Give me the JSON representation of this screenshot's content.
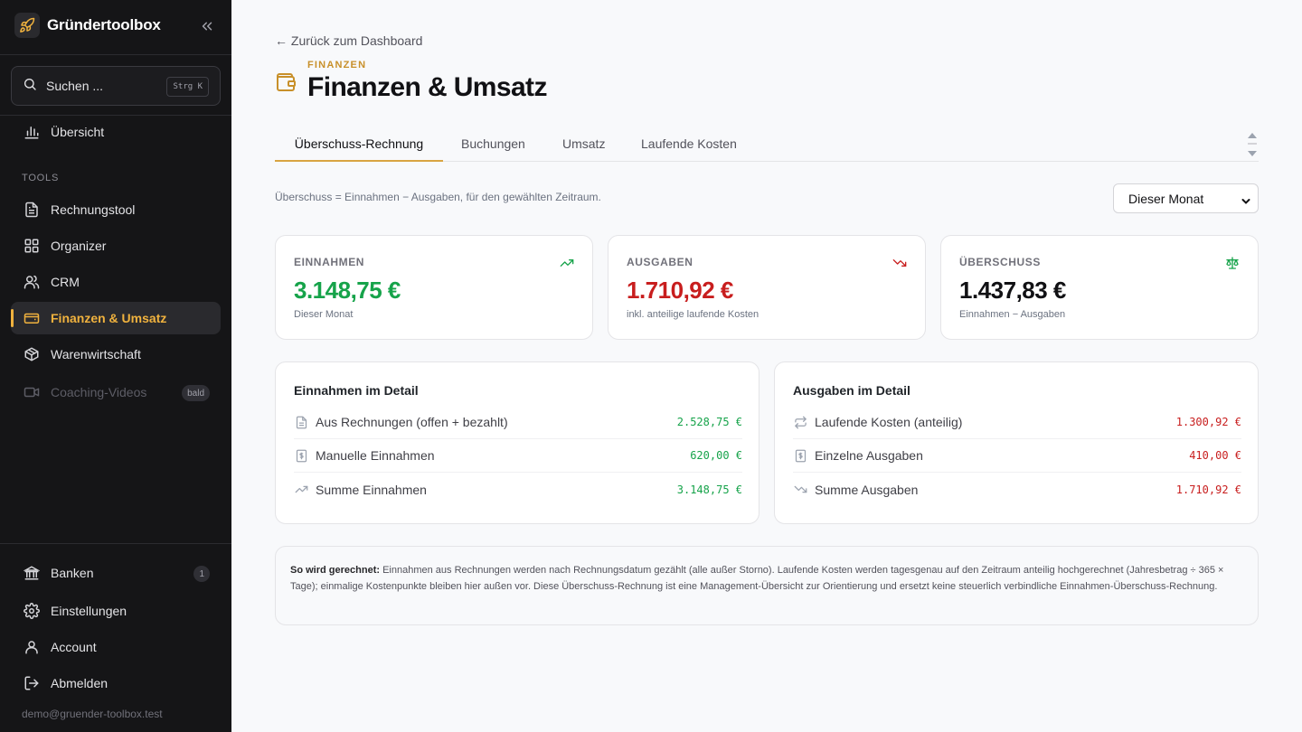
{
  "brand": {
    "name": "Gründertoolbox"
  },
  "search": {
    "placeholder": "Suchen ...",
    "shortcut": "Strg K"
  },
  "nav": {
    "overview": "Übersicht",
    "section_label": "TOOLS",
    "items": [
      {
        "label": "Rechnungstool",
        "icon": "document-icon"
      },
      {
        "label": "Organizer",
        "icon": "grid-icon"
      },
      {
        "label": "CRM",
        "icon": "users-icon"
      },
      {
        "label": "Finanzen & Umsatz",
        "icon": "wallet-icon"
      },
      {
        "label": "Warenwirtschaft",
        "icon": "box-icon"
      },
      {
        "label": "Coaching-Videos",
        "icon": "video-icon",
        "badge": "bald"
      }
    ],
    "bottom": [
      {
        "label": "Banken",
        "icon": "bank-icon",
        "badge": "1"
      },
      {
        "label": "Einstellungen",
        "icon": "gear-icon"
      },
      {
        "label": "Account",
        "icon": "user-icon"
      },
      {
        "label": "Abmelden",
        "icon": "logout-icon"
      }
    ],
    "email": "demo@gruender-toolbox.test"
  },
  "colors": {
    "accent": "#f0b23e",
    "income": "#16a34a",
    "expense": "#c81e1e",
    "sidebar_bg": "#151517"
  },
  "page": {
    "back_link": "← Zurück zum Dashboard",
    "kicker": "FINANZEN",
    "title": "Finanzen & Umsatz",
    "tabs": [
      "Überschuss-Rechnung",
      "Buchungen",
      "Umsatz",
      "Laufende Kosten"
    ],
    "hint": "Überschuss = Einnahmen − Ausgaben, für den gewählten Zeitraum.",
    "period": "Dieser Monat"
  },
  "kpis": [
    {
      "label": "EINNAHMEN",
      "value": "3.148,75 €",
      "sub": "Dieser Monat",
      "icon": "trending-up-icon"
    },
    {
      "label": "AUSGABEN",
      "value": "1.710,92 €",
      "sub": "inkl. anteilige laufende Kosten",
      "icon": "trending-down-icon"
    },
    {
      "label": "ÜBERSCHUSS",
      "value": "1.437,83 €",
      "sub": "Einnahmen − Ausgaben",
      "icon": "scale-icon"
    }
  ],
  "income_detail": {
    "title": "Einnahmen im Detail",
    "rows": [
      {
        "label": "Aus Rechnungen (offen + bezahlt)",
        "value": "2.528,75 €",
        "icon": "document-icon"
      },
      {
        "label": "Manuelle Einnahmen",
        "value": "620,00 €",
        "icon": "receipt-icon"
      },
      {
        "label": "Summe Einnahmen",
        "value": "3.148,75 €",
        "icon": "trending-up-icon"
      }
    ]
  },
  "expense_detail": {
    "title": "Ausgaben im Detail",
    "rows": [
      {
        "label": "Laufende Kosten (anteilig)",
        "value": "1.300,92 €",
        "icon": "repeat-icon"
      },
      {
        "label": "Einzelne Ausgaben",
        "value": "410,00 €",
        "icon": "receipt-icon"
      },
      {
        "label": "Summe Ausgaben",
        "value": "1.710,92 €",
        "icon": "trending-down-icon"
      }
    ]
  },
  "note": {
    "lead": "So wird gerechnet:",
    "text": "Einnahmen aus Rechnungen werden nach Rechnungsdatum gezählt (alle außer Storno). Laufende Kosten werden tagesgenau auf den Zeitraum anteilig hochgerechnet (Jahresbetrag ÷ 365 × Tage); einmalige Kostenpunkte bleiben hier außen vor. Diese Überschuss-Rechnung ist eine Management-Übersicht zur Orientierung und ersetzt keine steuerlich verbindliche Einnahmen-Überschuss-Rechnung."
  }
}
